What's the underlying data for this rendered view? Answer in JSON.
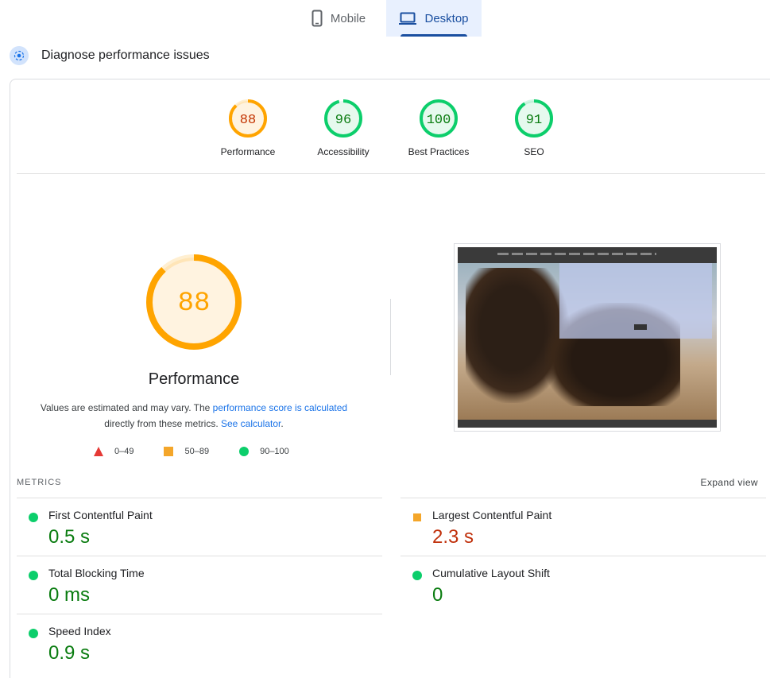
{
  "tabs": [
    {
      "label": "Mobile",
      "icon": "phone-icon",
      "selected": false
    },
    {
      "label": "Desktop",
      "icon": "laptop-icon",
      "selected": true
    }
  ],
  "diagnose": {
    "title": "Diagnose performance issues"
  },
  "categories": [
    {
      "label": "Performance",
      "score": "88",
      "status": "average"
    },
    {
      "label": "Accessibility",
      "score": "96",
      "status": "pass"
    },
    {
      "label": "Best Practices",
      "score": "100",
      "status": "pass"
    },
    {
      "label": "SEO",
      "score": "91",
      "status": "pass"
    }
  ],
  "main": {
    "score": "88",
    "title": "Performance",
    "desc_prefix": "Values are estimated and may vary. The ",
    "desc_link1": "performance score is calculated",
    "desc_mid": " directly from these metrics. ",
    "desc_link2": "See calculator",
    "desc_suffix": "."
  },
  "legend": [
    {
      "range": "0–49",
      "shape": "triangle",
      "color": "#e53935"
    },
    {
      "range": "50–89",
      "shape": "square",
      "color": "#f4a62a"
    },
    {
      "range": "90–100",
      "shape": "circle",
      "color": "#0cce6b"
    }
  ],
  "metrics_section": {
    "heading": "METRICS",
    "expand_label": "Expand view"
  },
  "metrics": [
    {
      "label": "First Contentful Paint",
      "value": "0.5 s",
      "status": "pass"
    },
    {
      "label": "Largest Contentful Paint",
      "value": "2.3 s",
      "status": "average"
    },
    {
      "label": "Total Blocking Time",
      "value": "0 ms",
      "status": "pass"
    },
    {
      "label": "Cumulative Layout Shift",
      "value": "0",
      "status": "pass"
    },
    {
      "label": "Speed Index",
      "value": "0.9 s",
      "status": "pass"
    }
  ],
  "colors": {
    "pass": "#0cce6b",
    "average": "#ffa400",
    "fail": "#ff4e42",
    "accent": "#1a73e8"
  }
}
